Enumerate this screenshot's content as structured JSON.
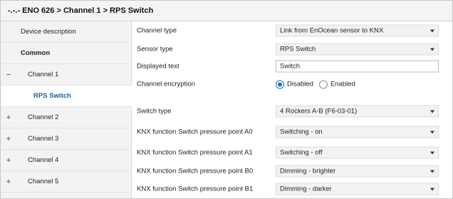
{
  "header": {
    "title": "-.-.- ENO 626 > Channel 1 > RPS Switch"
  },
  "sidebar": {
    "items": [
      {
        "label": "Device description",
        "symbol": ""
      },
      {
        "label": "Common",
        "symbol": ""
      },
      {
        "label": "Channel 1",
        "symbol": "−"
      },
      {
        "label": "RPS Switch",
        "symbol": ""
      },
      {
        "label": "Channel 2",
        "symbol": "+"
      },
      {
        "label": "Channel 3",
        "symbol": "+"
      },
      {
        "label": "Channel 4",
        "symbol": "+"
      },
      {
        "label": "Channel 5",
        "symbol": "+"
      }
    ]
  },
  "params": {
    "channel_type": {
      "label": "Channel type",
      "value": "Link from EnOcean sensor to KNX"
    },
    "sensor_type": {
      "label": "Sensor type",
      "value": "RPS Switch"
    },
    "displayed_text": {
      "label": "Displayed text",
      "value": "Switch"
    },
    "channel_encryption": {
      "label": "Channel encryption",
      "options": [
        "Disabled",
        "Enabled"
      ],
      "selected": "Disabled"
    },
    "switch_type": {
      "label": "Switch type",
      "value": "4 Rockers A-B (F6-03-01)"
    },
    "a0": {
      "label": "KNX function Switch pressure point A0",
      "value": "Switching - on"
    },
    "a1": {
      "label": "KNX function Switch pressure point A1",
      "value": "Switching - off"
    },
    "b0": {
      "label": "KNX function Switch pressure point B0",
      "value": "Dimming - brighter"
    },
    "b1": {
      "label": "KNX function Switch pressure point B1",
      "value": "Dimming - darker"
    }
  },
  "colors": {
    "accent": "#1e6fbf",
    "selected_text": "#1a5fa0"
  }
}
